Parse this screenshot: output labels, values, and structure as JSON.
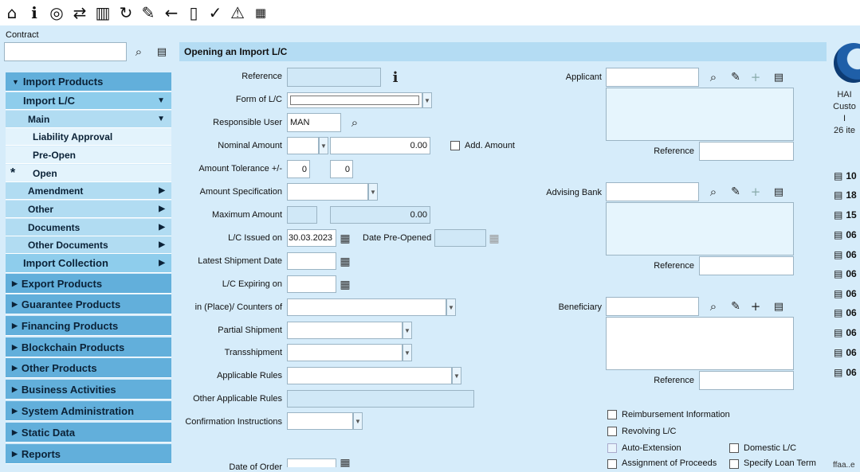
{
  "toolbar": {
    "icons": [
      "home-icon",
      "info-icon",
      "target-icon",
      "transfer-icon",
      "book-icon",
      "refresh-icon",
      "edit-icon",
      "back-arrow-icon",
      "doc-check-icon",
      "check-icon",
      "warning-icon",
      "calendar-icon"
    ]
  },
  "search": {
    "contract_label": "Contract",
    "contract_value": ""
  },
  "sidebar": {
    "items": [
      {
        "label": "Import Products",
        "level": 0,
        "expanded": true
      },
      {
        "label": "Import L/C",
        "level": 1,
        "expanded": true
      },
      {
        "label": "Main",
        "level": 2,
        "expanded": true
      },
      {
        "label": "Liability Approval",
        "level": 3
      },
      {
        "label": "Pre-Open",
        "level": 3
      },
      {
        "label": "Open",
        "level": 3,
        "active": true
      },
      {
        "label": "Amendment",
        "level": 2
      },
      {
        "label": "Other",
        "level": 2
      },
      {
        "label": "Documents",
        "level": 2
      },
      {
        "label": "Other Documents",
        "level": 2
      },
      {
        "label": "Import Collection",
        "level": 1
      },
      {
        "label": "Export Products",
        "level": 0
      },
      {
        "label": "Guarantee Products",
        "level": 0
      },
      {
        "label": "Financing Products",
        "level": 0
      },
      {
        "label": "Blockchain Products",
        "level": 0
      },
      {
        "label": "Other Products",
        "level": 0
      },
      {
        "label": "Business Activities",
        "level": 0
      },
      {
        "label": "System Administration",
        "level": 0
      },
      {
        "label": "Static Data",
        "level": 0
      },
      {
        "label": "Reports",
        "level": 0
      }
    ],
    "active_marker": "*"
  },
  "page_title": "Opening an Import L/C",
  "form": {
    "reference_label": "Reference",
    "form_of_lc_label": "Form of L/C",
    "responsible_user_label": "Responsible User",
    "responsible_user_value": "MAN",
    "nominal_amount_label": "Nominal Amount",
    "nominal_amount_value": "0.00",
    "add_amount_label": "Add. Amount",
    "tolerance_label": "Amount Tolerance +/-",
    "tolerance_plus": "0",
    "tolerance_minus": "0",
    "amount_spec_label": "Amount Specification",
    "maximum_amount_label": "Maximum Amount",
    "maximum_amount_value": "0.00",
    "issued_on_label": "L/C Issued on",
    "issued_on_value": "30.03.2023",
    "date_preopened_label": "Date Pre-Opened",
    "latest_shipment_label": "Latest Shipment Date",
    "expiring_label": "L/C Expiring on",
    "place_label": "in (Place)/ Counters of",
    "partial_shipment_label": "Partial Shipment",
    "transshipment_label": "Transshipment",
    "applicable_rules_label": "Applicable Rules",
    "other_rules_label": "Other Applicable Rules",
    "confirmation_label": "Confirmation Instructions",
    "date_of_order_label": "Date of Order"
  },
  "parties": {
    "applicant_label": "Applicant",
    "advising_bank_label": "Advising Bank",
    "beneficiary_label": "Beneficiary",
    "reference_label": "Reference"
  },
  "checkboxes": {
    "reimbursement": "Reimbursement Information",
    "revolving": "Revolving L/C",
    "auto_extension": "Auto-Extension",
    "domestic": "Domestic L/C",
    "assignment": "Assignment of Proceeds",
    "loan_term": "Specify Loan Term"
  },
  "right_panel": {
    "lines": [
      "HAI",
      "Custo",
      "I",
      "26 ite"
    ],
    "doc_items": [
      "10",
      "18",
      "15",
      "06",
      "06",
      "06",
      "06",
      "06",
      "06",
      "06",
      "06"
    ],
    "footer": "ffaa..e"
  }
}
